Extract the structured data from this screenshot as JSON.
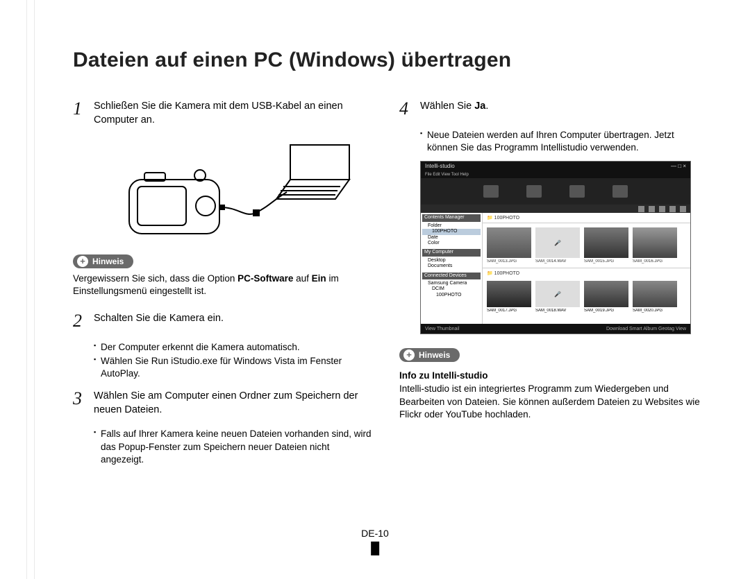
{
  "title": "Dateien auf einen PC (Windows) übertragen",
  "steps": {
    "s1": {
      "num": "1",
      "text": "Schließen Sie die Kamera mit dem USB-Kabel an einen Computer an."
    },
    "s2": {
      "num": "2",
      "text": "Schalten Sie die Kamera ein.",
      "bullets": [
        "Der Computer erkennt die Kamera automatisch.",
        "Wählen Sie Run iStudio.exe für Windows Vista im Fenster AutoPlay."
      ]
    },
    "s3": {
      "num": "3",
      "text": "Wählen Sie am Computer einen Ordner zum Speichern der neuen Dateien.",
      "bullets": [
        "Falls auf Ihrer Kamera keine neuen Dateien vorhanden sind, wird das Popup-Fenster zum Speichern neuer Dateien nicht angezeigt."
      ]
    },
    "s4": {
      "num": "4",
      "text_prefix": "Wählen Sie ",
      "text_bold": "Ja",
      "text_suffix": ".",
      "bullets": [
        "Neue Dateien werden auf Ihren Computer übertragen. Jetzt können Sie das Programm Intellistudio verwenden."
      ]
    }
  },
  "hinweis1": {
    "label": "Hinweis",
    "text_prefix": "Vergewissern Sie sich, dass die Option ",
    "text_bold1": "PC-Software",
    "text_mid": " auf ",
    "text_bold2": "Ein",
    "text_suffix": " im Einstellungsmenü eingestellt ist."
  },
  "hinweis2": {
    "label": "Hinweis",
    "heading": "Info zu Intelli-studio",
    "text": "Intelli-studio ist ein integriertes Programm zum Wiedergeben und Bearbeiten von Dateien. Sie können außerdem Dateien zu Websites wie Flickr oder YouTube hochladen."
  },
  "screenshot": {
    "title": "Intelli-studio",
    "menu": "File  Edit  View  Tool  Help",
    "side": {
      "hdr1": "Contents Manager",
      "items1": [
        "Folder",
        "100PHOTO",
        "Date",
        "Color"
      ],
      "hdr2": "My Computer",
      "items2": [
        "Desktop",
        "Documents"
      ],
      "hdr3": "Connected Devices",
      "items3": [
        "Samsung Camera",
        "DCIM",
        "100PHOTO"
      ]
    },
    "folders": [
      "100PHOTO"
    ],
    "thumbs1": [
      "SAM_0013.JPG",
      "SAM_0014.WAV",
      "SAM_0015.JPG",
      "SAM_0016.JPG"
    ],
    "folders2": [
      "100PHOTO"
    ],
    "thumbs2": [
      "SAM_0017.JPG",
      "SAM_0018.WAV",
      "SAM_0019.JPG",
      "SAM_0020.JPG"
    ],
    "footer_left": "View Thumbnail",
    "footer_right": "Download  Smart Album  Geotag View"
  },
  "page_number": "DE-10"
}
